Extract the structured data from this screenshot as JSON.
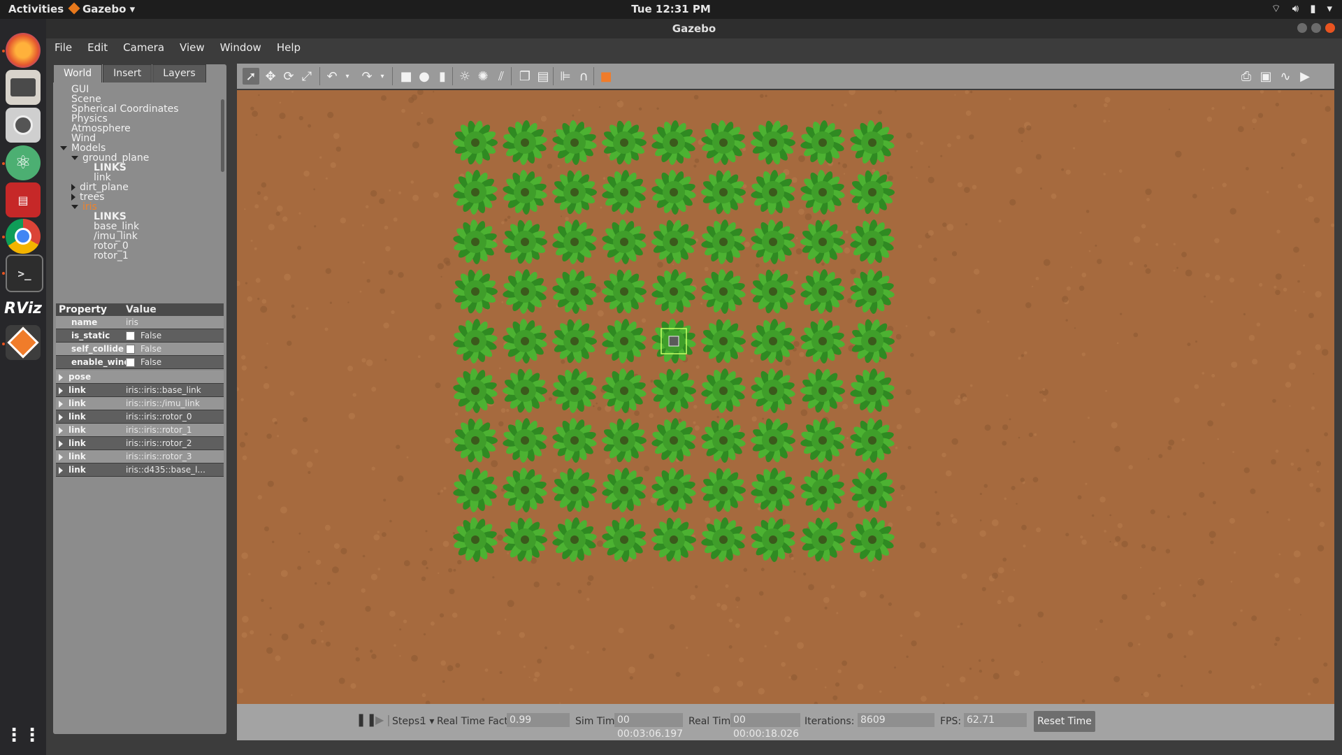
{
  "topbar": {
    "activities": "Activities",
    "app_name": "Gazebo",
    "clock": "Tue 12:31 PM"
  },
  "window": {
    "title": "Gazebo"
  },
  "menu": [
    "File",
    "Edit",
    "Camera",
    "View",
    "Window",
    "Help"
  ],
  "tabs": [
    "World",
    "Insert",
    "Layers"
  ],
  "tree": {
    "gui": "GUI",
    "scene": "Scene",
    "spherical": "Spherical Coordinates",
    "physics": "Physics",
    "atmosphere": "Atmosphere",
    "wind": "Wind",
    "models": "Models",
    "ground_plane": "ground_plane",
    "links1": "LINKS",
    "link": "link",
    "dirt_plane": "dirt_plane",
    "trees": "trees",
    "iris": "iris",
    "links2": "LINKS",
    "base_link": "base_link",
    "imu_link": "/imu_link",
    "rotor_0": "rotor_0",
    "rotor_1": "rotor_1"
  },
  "properties": {
    "header_property": "Property",
    "header_value": "Value",
    "name_label": "name",
    "name_value": "iris",
    "is_static_label": "is_static",
    "is_static_value": "False",
    "self_collide_label": "self_collide",
    "self_collide_value": "False",
    "enable_wind_label": "enable_wind",
    "enable_wind_value": "False",
    "pose_label": "pose",
    "links": [
      {
        "label": "link",
        "value": "iris::iris::base_link"
      },
      {
        "label": "link",
        "value": "iris::iris::/imu_link"
      },
      {
        "label": "link",
        "value": "iris::iris::rotor_0"
      },
      {
        "label": "link",
        "value": "iris::iris::rotor_1"
      },
      {
        "label": "link",
        "value": "iris::iris::rotor_2"
      },
      {
        "label": "link",
        "value": "iris::iris::rotor_3"
      },
      {
        "label": "link",
        "value": "iris::d435::base_l..."
      }
    ]
  },
  "bottom": {
    "steps_label": "Steps:",
    "steps_value": "1",
    "rtf_label": "Real Time Factor:",
    "rtf_value": "0.99",
    "sim_label": "Sim Time:",
    "sim_value": "00 00:03:06.197",
    "real_label": "Real Time:",
    "real_value": "00 00:00:18.026",
    "iter_label": "Iterations:",
    "iter_value": "8609",
    "fps_label": "FPS:",
    "fps_value": "62.71",
    "reset": "Reset Time"
  },
  "scene": {
    "rows": 9,
    "cols": 9,
    "plant_color": "#3f9e2a",
    "soil_color": "#a66a3e"
  },
  "colors": {
    "accent": "#e95420",
    "selected_tree_item": "#f0822a"
  }
}
